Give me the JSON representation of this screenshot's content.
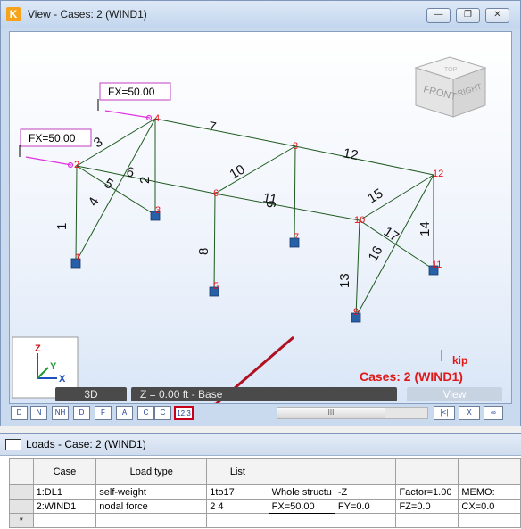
{
  "window": {
    "title": "View - Cases: 2 (WIND1)",
    "logo_letter": "K",
    "btn_minimize": "—",
    "btn_restore": "❐",
    "btn_close": "✕"
  },
  "viewport": {
    "force_labels": [
      "FX=50.00",
      "FX=50.00"
    ],
    "nodes": [
      "1",
      "2",
      "3",
      "4",
      "5",
      "6",
      "7",
      "8",
      "9",
      "10",
      "11",
      "12"
    ],
    "members": [
      "1",
      "2",
      "3",
      "4",
      "5",
      "6",
      "7",
      "8",
      "9",
      "10",
      "11",
      "12",
      "13",
      "14",
      "15",
      "16",
      "17"
    ],
    "cube_faces": [
      "FRONT",
      "RIGHT",
      "TOP"
    ],
    "axes": [
      "Z",
      "Y",
      "X"
    ],
    "unit": "kip",
    "case_label": "Cases: 2 (WIND1)",
    "band_3d": "3D",
    "band_z": "Z = 0.00 ft - Base",
    "band_view": "View",
    "scroll_thumb": "III",
    "colors": {
      "node_label": "#e8101a",
      "member": "#1e5a1e",
      "load_arrow": "#e032e0",
      "support": "#2860a8",
      "accent": "#c8001a"
    }
  },
  "toolbar": {
    "buttons": [
      "D",
      "N",
      "NH",
      "D",
      "F",
      "A",
      "C",
      "12.3"
    ],
    "right_buttons": [
      "|<|",
      "X",
      "∞"
    ]
  },
  "loads_panel": {
    "title": "Loads - Case: 2 (WIND1)",
    "headers": [
      "Case",
      "Load type",
      "List",
      "",
      "",
      "",
      ""
    ],
    "rows": [
      [
        "1:DL1",
        "self-weight",
        "1to17",
        "Whole structu",
        "-Z",
        "Factor=1.00",
        "MEMO:"
      ],
      [
        "2:WIND1",
        "nodal force",
        "2 4",
        "FX=50.00",
        "FY=0.0",
        "FZ=0.0",
        "CX=0.0"
      ]
    ],
    "new_row_marker": "*"
  }
}
